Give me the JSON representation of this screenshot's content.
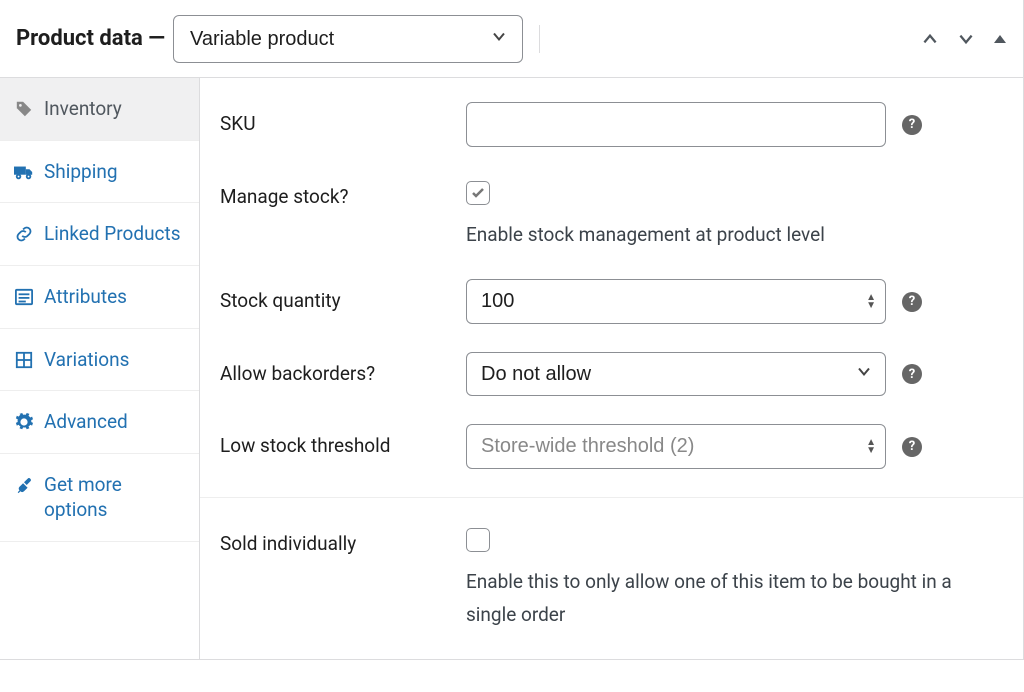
{
  "header": {
    "title": "Product data —",
    "product_type": "Variable product"
  },
  "tabs": {
    "inventory": "Inventory",
    "shipping": "Shipping",
    "linked_products": "Linked Products",
    "attributes": "Attributes",
    "variations": "Variations",
    "advanced": "Advanced",
    "get_more": "Get more options"
  },
  "fields": {
    "sku": {
      "label": "SKU",
      "value": ""
    },
    "manage_stock": {
      "label": "Manage stock?",
      "checked": true,
      "description": "Enable stock management at product level"
    },
    "stock_quantity": {
      "label": "Stock quantity",
      "value": "100"
    },
    "allow_backorders": {
      "label": "Allow backorders?",
      "value": "Do not allow"
    },
    "low_stock_threshold": {
      "label": "Low stock threshold",
      "placeholder": "Store-wide threshold (2)"
    },
    "sold_individually": {
      "label": "Sold individually",
      "checked": false,
      "description": "Enable this to only allow one of this item to be bought in a single order"
    }
  }
}
